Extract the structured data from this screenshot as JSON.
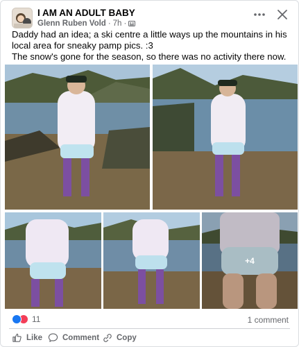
{
  "header": {
    "group_name": "I AM AN ADULT BABY",
    "author": "Glenn Ruben Vold",
    "separator": "·",
    "time": "7h",
    "more_icon": "more-horizontal-icon",
    "close_icon": "close-icon",
    "privacy_icon": "group-privacy-icon"
  },
  "post": {
    "caption_line1": "Daddy had an idea; a ski centre a little ways up the mountains in his local area for sneaky pamp pics. :3",
    "caption_line2": "The snow's gone for the season, so there was no activity there now. :D"
  },
  "photos": {
    "count": 5,
    "more_count_label": "+4"
  },
  "footer": {
    "reaction_count": "11",
    "comment_count_label": "1 comment",
    "like_label": "Like",
    "comment_label": "Comment",
    "copy_label": "Copy",
    "reaction_icons": [
      "like-reaction-icon",
      "love-reaction-icon"
    ]
  },
  "colors": {
    "accent": "#1877f2",
    "love": "#f33e58",
    "secondary_text": "#65676b",
    "divider": "#ced0d4"
  }
}
